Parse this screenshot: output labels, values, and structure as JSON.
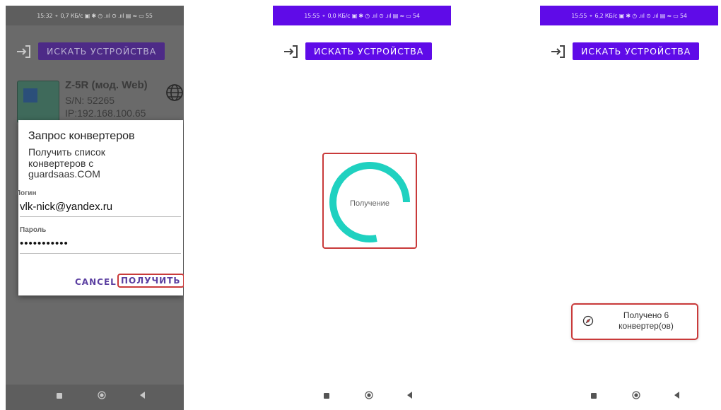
{
  "screens": [
    {
      "status": "15:32 ⚬  0,7 КБ/с ▣ ✱ ◷ .ııl ⊙ .ııl ▤ ≈ ▭ 55",
      "toolbar": {
        "login_icon": "login-arrow-icon",
        "search_label": "ИСКАТЬ УСТРОЙСТВА"
      },
      "device": {
        "name": "Z-5R (мод. Web)",
        "sn": "S/N: 52265",
        "ip": "IP:192.168.100.65",
        "icon": "globe-icon"
      },
      "dialog": {
        "title": "Запрос конвертеров",
        "message": "Получить список конвертеров с guardsaas.COM",
        "login_label": "Логин",
        "login_value": "vlk-nick@yandex.ru",
        "password_label": "Пароль",
        "password_value": "•••••••••••",
        "cancel_label": "CANCEL",
        "get_label": "ПОЛУЧИТЬ"
      }
    },
    {
      "status": "15:55 ⚬  0,0 КБ/с ▣ ✱ ◷ .ııl ⊙ .ııl ▤ ≈ ▭ 54",
      "toolbar": {
        "login_icon": "login-arrow-icon",
        "search_label": "ИСКАТЬ УСТРОЙСТВА"
      },
      "progress": {
        "label": "Получение",
        "fraction": 0.78,
        "color": "#1fd1c0"
      }
    },
    {
      "status": "15:55 ⚬  6,2 КБ/с ▣ ✱ ◷ .ııl ⊙ .ııl ▤ ≈ ▭ 54",
      "toolbar": {
        "login_icon": "login-arrow-icon",
        "search_label": "ИСКАТЬ УСТРОЙСТВА"
      },
      "toast": {
        "text": "Получено 6 конвертер(ов)",
        "icon": "app-compass-icon"
      }
    }
  ],
  "colors": {
    "accent": "#5f0be8",
    "highlight": "#c93a3a",
    "progress": "#1fd1c0"
  }
}
